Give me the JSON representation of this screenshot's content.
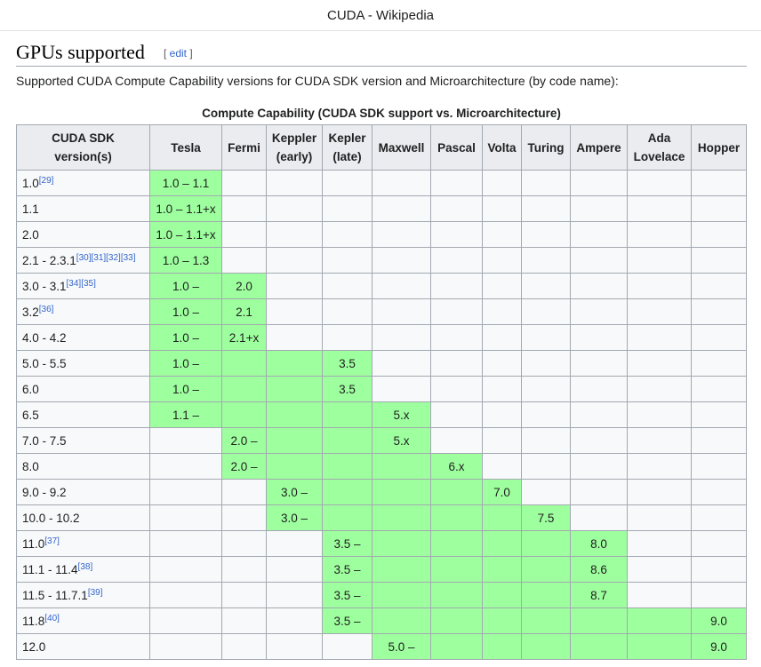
{
  "window": {
    "title": "CUDA - Wikipedia"
  },
  "section": {
    "title": "GPUs supported",
    "edit_open": "[ ",
    "edit_link": "edit",
    "edit_close": " ]"
  },
  "intro": "Supported CUDA Compute Capability versions for CUDA SDK version and Microarchitecture (by code name):",
  "table": {
    "caption": "Compute Capability (CUDA SDK support vs. Microarchitecture)",
    "headers": [
      [
        "CUDA SDK",
        "version(s)"
      ],
      [
        "Tesla"
      ],
      [
        "Fermi"
      ],
      [
        "Keppler",
        "(early)"
      ],
      [
        "Kepler",
        "(late)"
      ],
      [
        "Maxwell"
      ],
      [
        "Pascal"
      ],
      [
        "Volta"
      ],
      [
        "Turing"
      ],
      [
        "Ampere"
      ],
      [
        "Ada",
        "Lovelace"
      ],
      [
        "Hopper"
      ]
    ],
    "colors": {
      "supported": "#9eff9e",
      "unsupported": "#f8f9fa",
      "header": "#eaecf0",
      "link": "#3366cc"
    },
    "rows": [
      {
        "sdk": "1.0",
        "refs": "[29]",
        "cells": [
          [
            "1.0 – 1.1",
            1
          ],
          [
            "",
            0
          ],
          [
            "",
            0
          ],
          [
            "",
            0
          ],
          [
            "",
            0
          ],
          [
            "",
            0
          ],
          [
            "",
            0
          ],
          [
            "",
            0
          ],
          [
            "",
            0
          ],
          [
            "",
            0
          ],
          [
            "",
            0
          ]
        ]
      },
      {
        "sdk": "1.1",
        "refs": "",
        "cells": [
          [
            "1.0 – 1.1+x",
            1
          ],
          [
            "",
            0
          ],
          [
            "",
            0
          ],
          [
            "",
            0
          ],
          [
            "",
            0
          ],
          [
            "",
            0
          ],
          [
            "",
            0
          ],
          [
            "",
            0
          ],
          [
            "",
            0
          ],
          [
            "",
            0
          ],
          [
            "",
            0
          ]
        ]
      },
      {
        "sdk": "2.0",
        "refs": "",
        "cells": [
          [
            "1.0 – 1.1+x",
            1
          ],
          [
            "",
            0
          ],
          [
            "",
            0
          ],
          [
            "",
            0
          ],
          [
            "",
            0
          ],
          [
            "",
            0
          ],
          [
            "",
            0
          ],
          [
            "",
            0
          ],
          [
            "",
            0
          ],
          [
            "",
            0
          ],
          [
            "",
            0
          ]
        ]
      },
      {
        "sdk": "2.1 - 2.3.1",
        "refs": "[30][31][32][33]",
        "cells": [
          [
            "1.0 – 1.3",
            1
          ],
          [
            "",
            0
          ],
          [
            "",
            0
          ],
          [
            "",
            0
          ],
          [
            "",
            0
          ],
          [
            "",
            0
          ],
          [
            "",
            0
          ],
          [
            "",
            0
          ],
          [
            "",
            0
          ],
          [
            "",
            0
          ],
          [
            "",
            0
          ]
        ]
      },
      {
        "sdk": "3.0 - 3.1",
        "refs": "[34][35]",
        "cells": [
          [
            "1.0 –",
            1
          ],
          [
            "2.0",
            1
          ],
          [
            "",
            0
          ],
          [
            "",
            0
          ],
          [
            "",
            0
          ],
          [
            "",
            0
          ],
          [
            "",
            0
          ],
          [
            "",
            0
          ],
          [
            "",
            0
          ],
          [
            "",
            0
          ],
          [
            "",
            0
          ]
        ]
      },
      {
        "sdk": "3.2",
        "refs": "[36]",
        "cells": [
          [
            "1.0 –",
            1
          ],
          [
            "2.1",
            1
          ],
          [
            "",
            0
          ],
          [
            "",
            0
          ],
          [
            "",
            0
          ],
          [
            "",
            0
          ],
          [
            "",
            0
          ],
          [
            "",
            0
          ],
          [
            "",
            0
          ],
          [
            "",
            0
          ],
          [
            "",
            0
          ]
        ]
      },
      {
        "sdk": "4.0 - 4.2",
        "refs": "",
        "cells": [
          [
            "1.0 –",
            1
          ],
          [
            "2.1+x",
            1
          ],
          [
            "",
            0
          ],
          [
            "",
            0
          ],
          [
            "",
            0
          ],
          [
            "",
            0
          ],
          [
            "",
            0
          ],
          [
            "",
            0
          ],
          [
            "",
            0
          ],
          [
            "",
            0
          ],
          [
            "",
            0
          ]
        ]
      },
      {
        "sdk": "5.0 - 5.5",
        "refs": "",
        "cells": [
          [
            "1.0 –",
            1
          ],
          [
            "",
            1
          ],
          [
            "",
            1
          ],
          [
            "3.5",
            1
          ],
          [
            "",
            0
          ],
          [
            "",
            0
          ],
          [
            "",
            0
          ],
          [
            "",
            0
          ],
          [
            "",
            0
          ],
          [
            "",
            0
          ],
          [
            "",
            0
          ]
        ]
      },
      {
        "sdk": "6.0",
        "refs": "",
        "cells": [
          [
            "1.0 –",
            1
          ],
          [
            "",
            1
          ],
          [
            "",
            1
          ],
          [
            "3.5",
            1
          ],
          [
            "",
            0
          ],
          [
            "",
            0
          ],
          [
            "",
            0
          ],
          [
            "",
            0
          ],
          [
            "",
            0
          ],
          [
            "",
            0
          ],
          [
            "",
            0
          ]
        ]
      },
      {
        "sdk": "6.5",
        "refs": "",
        "cells": [
          [
            "1.1 –",
            1
          ],
          [
            "",
            1
          ],
          [
            "",
            1
          ],
          [
            "",
            1
          ],
          [
            "5.x",
            1
          ],
          [
            "",
            0
          ],
          [
            "",
            0
          ],
          [
            "",
            0
          ],
          [
            "",
            0
          ],
          [
            "",
            0
          ],
          [
            "",
            0
          ]
        ]
      },
      {
        "sdk": "7.0 - 7.5",
        "refs": "",
        "cells": [
          [
            "",
            0
          ],
          [
            "2.0 –",
            1
          ],
          [
            "",
            1
          ],
          [
            "",
            1
          ],
          [
            "5.x",
            1
          ],
          [
            "",
            0
          ],
          [
            "",
            0
          ],
          [
            "",
            0
          ],
          [
            "",
            0
          ],
          [
            "",
            0
          ],
          [
            "",
            0
          ]
        ]
      },
      {
        "sdk": "8.0",
        "refs": "",
        "cells": [
          [
            "",
            0
          ],
          [
            "2.0 –",
            1
          ],
          [
            "",
            1
          ],
          [
            "",
            1
          ],
          [
            "",
            1
          ],
          [
            "6.x",
            1
          ],
          [
            "",
            0
          ],
          [
            "",
            0
          ],
          [
            "",
            0
          ],
          [
            "",
            0
          ],
          [
            "",
            0
          ]
        ]
      },
      {
        "sdk": "9.0 - 9.2",
        "refs": "",
        "cells": [
          [
            "",
            0
          ],
          [
            "",
            0
          ],
          [
            "3.0 –",
            1
          ],
          [
            "",
            1
          ],
          [
            "",
            1
          ],
          [
            "",
            1
          ],
          [
            "7.0",
            1
          ],
          [
            "",
            0
          ],
          [
            "",
            0
          ],
          [
            "",
            0
          ],
          [
            "",
            0
          ]
        ]
      },
      {
        "sdk": "10.0 - 10.2",
        "refs": "",
        "cells": [
          [
            "",
            0
          ],
          [
            "",
            0
          ],
          [
            "3.0 –",
            1
          ],
          [
            "",
            1
          ],
          [
            "",
            1
          ],
          [
            "",
            1
          ],
          [
            "",
            1
          ],
          [
            "7.5",
            1
          ],
          [
            "",
            0
          ],
          [
            "",
            0
          ],
          [
            "",
            0
          ]
        ]
      },
      {
        "sdk": "11.0",
        "refs": "[37]",
        "cells": [
          [
            "",
            0
          ],
          [
            "",
            0
          ],
          [
            "",
            0
          ],
          [
            "3.5 –",
            1
          ],
          [
            "",
            1
          ],
          [
            "",
            1
          ],
          [
            "",
            1
          ],
          [
            "",
            1
          ],
          [
            "8.0",
            1
          ],
          [
            "",
            0
          ],
          [
            "",
            0
          ]
        ]
      },
      {
        "sdk": "11.1 - 11.4",
        "refs": "[38]",
        "cells": [
          [
            "",
            0
          ],
          [
            "",
            0
          ],
          [
            "",
            0
          ],
          [
            "3.5 –",
            1
          ],
          [
            "",
            1
          ],
          [
            "",
            1
          ],
          [
            "",
            1
          ],
          [
            "",
            1
          ],
          [
            "8.6",
            1
          ],
          [
            "",
            0
          ],
          [
            "",
            0
          ]
        ]
      },
      {
        "sdk": "11.5 - 11.7.1",
        "refs": "[39]",
        "cells": [
          [
            "",
            0
          ],
          [
            "",
            0
          ],
          [
            "",
            0
          ],
          [
            "3.5 –",
            1
          ],
          [
            "",
            1
          ],
          [
            "",
            1
          ],
          [
            "",
            1
          ],
          [
            "",
            1
          ],
          [
            "8.7",
            1
          ],
          [
            "",
            0
          ],
          [
            "",
            0
          ]
        ]
      },
      {
        "sdk": "11.8",
        "refs": "[40]",
        "cells": [
          [
            "",
            0
          ],
          [
            "",
            0
          ],
          [
            "",
            0
          ],
          [
            "3.5 –",
            1
          ],
          [
            "",
            1
          ],
          [
            "",
            1
          ],
          [
            "",
            1
          ],
          [
            "",
            1
          ],
          [
            "",
            1
          ],
          [
            "",
            1
          ],
          [
            "9.0",
            1
          ]
        ]
      },
      {
        "sdk": "12.0",
        "refs": "",
        "cells": [
          [
            "",
            0
          ],
          [
            "",
            0
          ],
          [
            "",
            0
          ],
          [
            "",
            0
          ],
          [
            "5.0 –",
            1
          ],
          [
            "",
            1
          ],
          [
            "",
            1
          ],
          [
            "",
            1
          ],
          [
            "",
            1
          ],
          [
            "",
            1
          ],
          [
            "9.0",
            1
          ]
        ]
      }
    ]
  }
}
